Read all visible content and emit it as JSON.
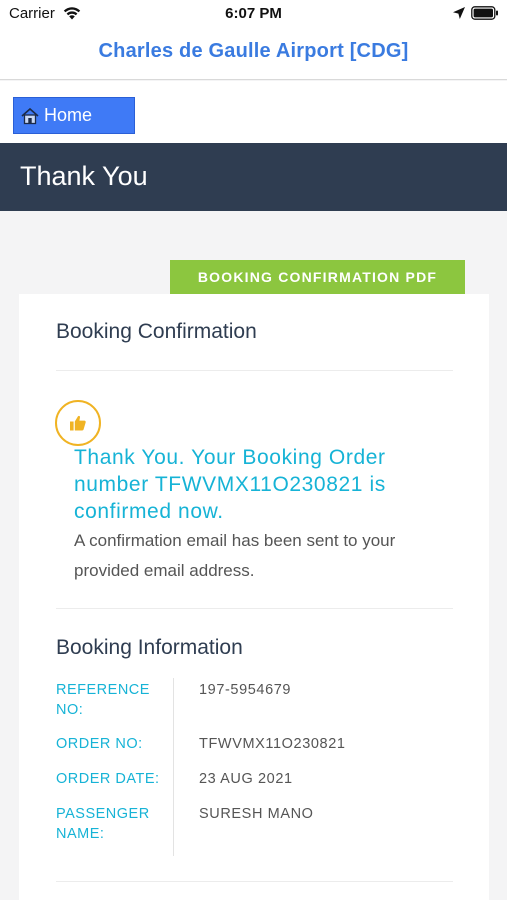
{
  "status_bar": {
    "carrier": "Carrier",
    "time": "6:07 PM",
    "icons": [
      "wifi-icon",
      "location-arrow-icon",
      "battery-icon"
    ]
  },
  "nav": {
    "title": "Charles de Gaulle Airport [CDG]",
    "title_color": "#3a7be0"
  },
  "home_button": {
    "label": "Home",
    "icon": "home-icon",
    "color": "#3f7af6"
  },
  "page_header": {
    "title": "Thank You",
    "color": "#2f3d51"
  },
  "pdf_button": {
    "label": "BOOKING CONFIRMATION PDF",
    "color": "#8cc63f"
  },
  "booking_confirmation": {
    "title": "Booking Confirmation",
    "icon": "thumbs-up-icon",
    "icon_color": "#f0b323",
    "message": "Thank You. Your Booking Order number TFWVMX11O230821 is confirmed now.",
    "message_color": "#16b3d6",
    "sub_message": "A confirmation email has been sent to your provided email address."
  },
  "booking_information": {
    "title": "Booking Information",
    "rows": [
      {
        "label": "REFERENCE NO:",
        "value": "197-5954679"
      },
      {
        "label": "ORDER NO:",
        "value": "TFWVMX11O230821"
      },
      {
        "label": "ORDER DATE:",
        "value": "23 AUG 2021"
      },
      {
        "label": "PASSENGER NAME:",
        "value": "SURESH MANO"
      }
    ]
  }
}
